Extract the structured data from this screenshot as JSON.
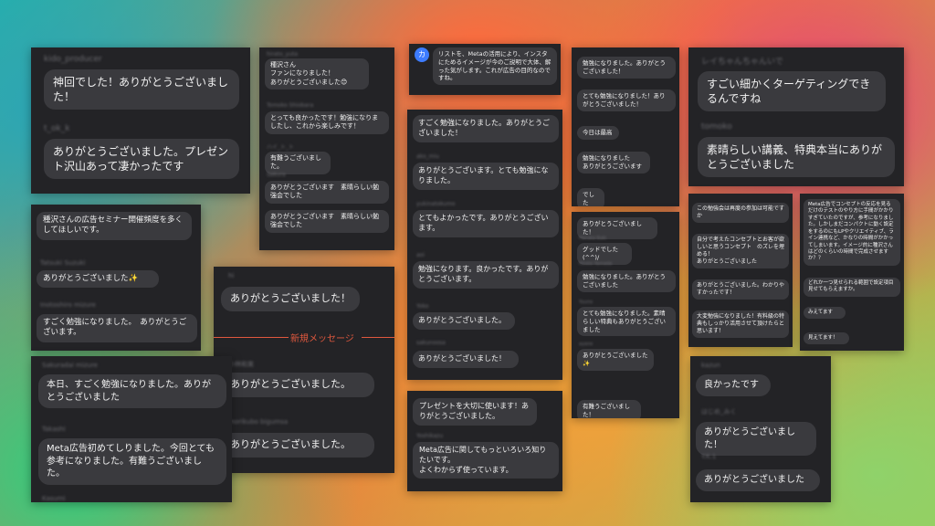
{
  "panel1": {
    "names": [
      "kido_producer",
      "t_ok_k"
    ],
    "messages": [
      "神回でした！ありがとうございました！",
      "ありがとうございました。プレゼント沢山あって凄かったです"
    ]
  },
  "panel2": {
    "names": [
      "hirato_yuta",
      "Tomoko Shiobara",
      "ハイ_ト_ト",
      "Sakura"
    ],
    "messages": [
      "種沢さん\nファンになりました！\nありがとうございました😊",
      "とっても良かったです！勉強になりましたし、これから楽しみです！",
      "有難うございました。",
      "ありがとうございます　素晴らしい勉強会でした",
      "ありがとうございます　素晴らしい勉強会でした"
    ]
  },
  "panel3": {
    "avatar_letter": "カ",
    "message": "リストを、Metaの活用により、インスタにためるイメージが今のご説明で大体、解った気がします。これが広告の目的なのですね。"
  },
  "panel4": {
    "messages": [
      "勉強になりました。ありがとうございました！",
      "とても勉強になりました！ありがとうございました！",
      "今日は最高",
      "勉強になりました\nありがとうございます",
      "でした"
    ]
  },
  "panel5": {
    "names": [
      "レイちゃんちゃんいで",
      "tomoko"
    ],
    "messages": [
      "すごい細かくターゲティングできるんですね",
      "素晴らしい講義、特典本当にありがとうございました"
    ]
  },
  "panel6": {
    "names": [
      "Tatsuki Suzuki",
      "Inotoshiro mizure"
    ],
    "messages": [
      "種沢さんの広告セミナー開催頻度を多くしてほしいです。",
      "ありがとうございました✨",
      "すごく勉強になりました。　ありがとうございます。"
    ]
  },
  "panel7": {
    "names": [
      "ako_miu",
      "yukinatokumo",
      "aoi",
      "Yoko",
      "sakunoosa"
    ],
    "messages": [
      "すごく勉強になりました。ありがとうございました！",
      "ありがとうございます。とても勉強になりました。",
      "とてもよかったです。ありがとうございます。",
      "勉強になります。良かったです。ありがとうございます。",
      "ありがとうございました。",
      "ありがとうございました！"
    ]
  },
  "panel8": {
    "names": [
      "Haruka Kuki",
      "Hiroto Yamada",
      "Yuuna",
      "ayane"
    ],
    "messages": [
      "ありがとうございました！",
      "グッドでした(^^)/",
      "勉強になりました。ありがとうございました",
      "とても勉強になりました。素晴らしい特典もありがとうございました",
      "ありがとうございました✨",
      "有難うございました！"
    ]
  },
  "panel9": {
    "messages": [
      "この勉強会は再度の参加は可能ですか",
      "自分で考えたコンセプトとお客が欲しいと思うコンセプト　のズレを埋める！\nありがとうございました",
      "ありがとうございました。わかりやすかったです！",
      "大変勉強になりました！有料級の特典もしっかり活用させて頂けたらと思います！"
    ]
  },
  "panel10": {
    "messages": [
      "Meta広告でコンセプトの反応を見るだけのテストのやり方に手間がかかりすぎていたのですが、参考になりました。しかしまだコンパクトに動く設定をするのにもLPやクリエイティブ、ライン連携など、かなりの時間がかかってしまいます。イメージ的に種沢さんはどのくらいの時間で完成させますか？？",
      "どれか一つ見せられる範囲で設定項目見せてもらえますか。",
      "みえてます",
      "見えてます！"
    ]
  },
  "panel11": {
    "names": [
      "hi",
      "小林和実",
      "morikubo bigumsa"
    ],
    "messages": [
      "ありがとうございました！",
      "ありがとうございました。",
      "ありがとうございました。"
    ],
    "divider": "新規メッセージ"
  },
  "panel12": {
    "names": [
      "Sakuradai mizure",
      "Takashi",
      "Kasumi"
    ],
    "messages": [
      "本日、すごく勉強になりました。ありがとうございました",
      "Meta広告初めてしりました。今回とても参考になりました。有難うございました。"
    ]
  },
  "panel13": {
    "names": [
      "Yoshikazu"
    ],
    "messages": [
      "プレゼントを大切に使います！ありがとうございました。",
      "Meta広告に関してもっといろいろ知りたいです。\nよくわからず使っています。"
    ]
  },
  "panel14": {
    "names": [
      "kazun",
      "はじめ_みく",
      "Y.K.1"
    ],
    "messages": [
      "良かったです",
      "ありがとうございました！",
      "ありがとうございました"
    ]
  }
}
